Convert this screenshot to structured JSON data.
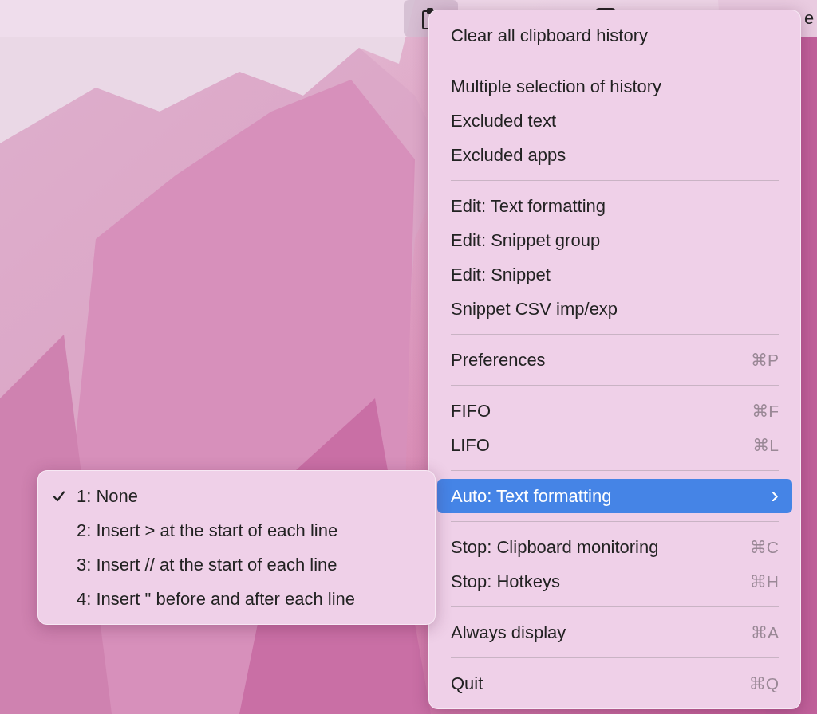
{
  "menu_bar": {
    "items": [
      {
        "kind": "icon",
        "selected": true
      },
      {
        "kind": "icon",
        "selected": false
      },
      {
        "kind": "text",
        "label": "e",
        "selected": false
      }
    ]
  },
  "menu": {
    "items": [
      {
        "kind": "item",
        "label": "Clear all clipboard history",
        "selected": false
      },
      {
        "kind": "separator"
      },
      {
        "kind": "item",
        "label": "Multiple selection of history",
        "selected": false
      },
      {
        "kind": "item",
        "label": "Excluded text",
        "selected": false
      },
      {
        "kind": "item",
        "label": "Excluded apps",
        "selected": false
      },
      {
        "kind": "separator"
      },
      {
        "kind": "item",
        "label": "Edit: Text formatting",
        "selected": false
      },
      {
        "kind": "item",
        "label": "Edit: Snippet group",
        "selected": false
      },
      {
        "kind": "item",
        "label": "Edit: Snippet",
        "selected": false
      },
      {
        "kind": "item",
        "label": "Snippet CSV imp/exp",
        "selected": false
      },
      {
        "kind": "separator"
      },
      {
        "kind": "item",
        "label": "Preferences",
        "shortcut": "⌘P",
        "selected": false
      },
      {
        "kind": "separator"
      },
      {
        "kind": "item",
        "label": "FIFO",
        "shortcut": "⌘F",
        "selected": false
      },
      {
        "kind": "item",
        "label": "LIFO",
        "shortcut": "⌘L",
        "selected": false
      },
      {
        "kind": "separator"
      },
      {
        "kind": "submenu",
        "label": "Auto: Text formatting",
        "chevron": "›",
        "selected": true
      },
      {
        "kind": "separator"
      },
      {
        "kind": "item",
        "label": "Stop: Clipboard monitoring",
        "shortcut": "⌘C",
        "selected": false
      },
      {
        "kind": "item",
        "label": "Stop: Hotkeys",
        "shortcut": "⌘H",
        "selected": false
      },
      {
        "kind": "separator"
      },
      {
        "kind": "item",
        "label": "Always display",
        "shortcut": "⌘A",
        "selected": false
      },
      {
        "kind": "separator"
      },
      {
        "kind": "item",
        "label": "Quit",
        "shortcut": "⌘Q",
        "selected": false
      }
    ]
  },
  "submenu": {
    "items": [
      {
        "label": "1: None",
        "checked": true
      },
      {
        "label": "2: Insert > at the start of each line",
        "checked": false
      },
      {
        "label": "3: Insert // at the start of each line",
        "checked": false
      },
      {
        "label": "4: Insert \" before and after each line",
        "checked": false
      }
    ]
  }
}
